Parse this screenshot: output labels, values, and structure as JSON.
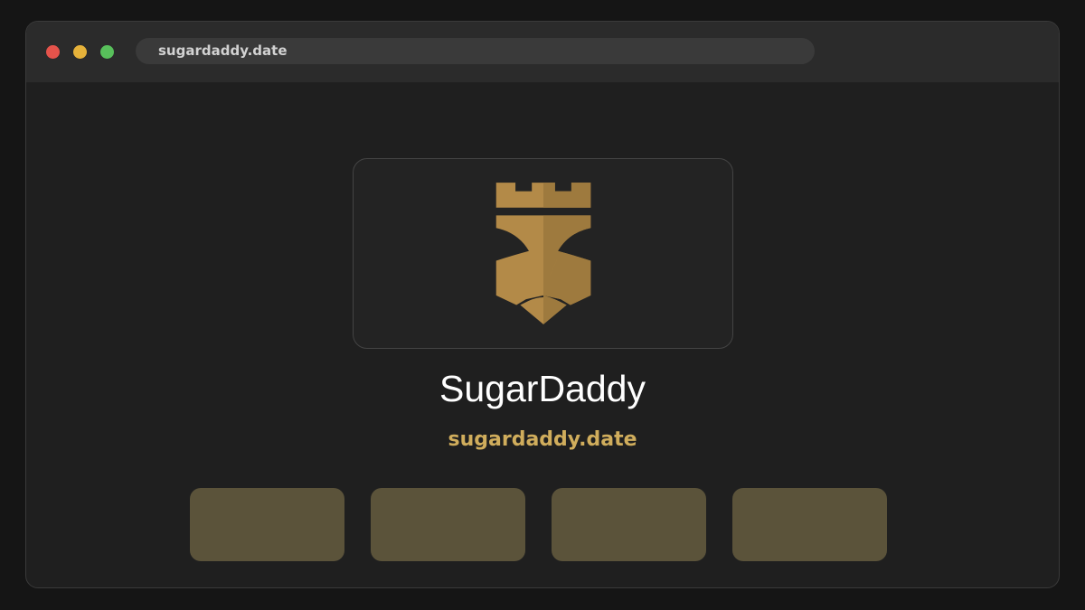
{
  "browser": {
    "url": "sugardaddy.date"
  },
  "brand": {
    "name": "SugarDaddy",
    "domain": "sugardaddy.date",
    "logo_icon": "crowned-lion-shield-icon",
    "accent_color": "#d0ad5c",
    "logo_color": "#b38a48"
  },
  "traffic_lights": {
    "close_color": "#e5534b",
    "minimize_color": "#e6b23a",
    "maximize_color": "#58c05b"
  },
  "tiles": {
    "count": 4,
    "color": "#5b533a"
  }
}
